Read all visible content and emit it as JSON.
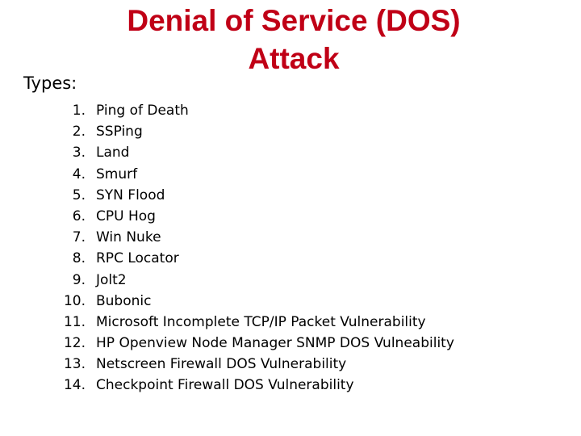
{
  "slide": {
    "background_color": "#ffffff",
    "title": {
      "color": "#C00016",
      "line1": "Denial of Service (DOS)",
      "line2": "Attack"
    },
    "types_label": "Types:",
    "types": [
      {
        "number": "1.",
        "label": "Ping of Death"
      },
      {
        "number": "2.",
        "label": "SSPing"
      },
      {
        "number": "3.",
        "label": "Land"
      },
      {
        "number": "4.",
        "label": "Smurf"
      },
      {
        "number": "5.",
        "label": "SYN Flood"
      },
      {
        "number": "6.",
        "label": "CPU Hog"
      },
      {
        "number": "7.",
        "label": "Win Nuke"
      },
      {
        "number": "8.",
        "label": "RPC Locator"
      },
      {
        "number": "9.",
        "label": "Jolt2"
      },
      {
        "number": "10.",
        "label": "Bubonic"
      },
      {
        "number": "11.",
        "label": "Microsoft Incomplete TCP/IP Packet Vulnerability"
      },
      {
        "number": "12.",
        "label": "HP Openview Node Manager SNMP DOS Vulneability"
      },
      {
        "number": "13.",
        "label": "Netscreen Firewall DOS Vulnerability"
      },
      {
        "number": "14.",
        "label": "Checkpoint Firewall DOS Vulnerability"
      }
    ]
  }
}
